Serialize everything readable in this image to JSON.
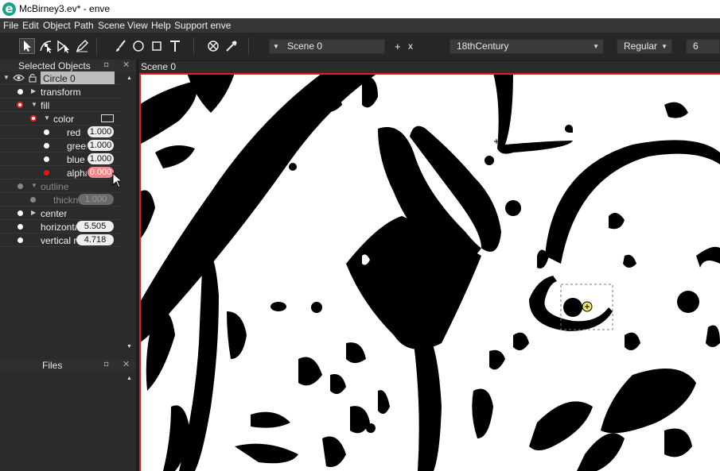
{
  "window": {
    "title": "McBirney3.ev* - enve",
    "app_icon": "enve-logo-icon"
  },
  "menu": [
    "File",
    "Edit",
    "Object",
    "Path",
    "Scene",
    "View",
    "Help",
    "Support enve"
  ],
  "toolbar": {
    "tools": [
      "pointer-icon",
      "node-edit-icon",
      "path-edit-icon",
      "pen-icon",
      "brush-icon",
      "circle-icon",
      "rectangle-icon",
      "text-icon",
      "null-object-icon",
      "color-picker-icon"
    ],
    "scene_select": "Scene 0",
    "add_label": "+",
    "remove_label": "x",
    "font_family": "18thCentury",
    "font_style": "Regular",
    "font_size": "6"
  },
  "selected_objects_panel": {
    "title": "Selected Objects",
    "object_name": "Circle 0",
    "rows": {
      "transform": "transform",
      "fill": "fill",
      "color": "color",
      "red": "red",
      "red_value": "1.000",
      "green": "green",
      "green_value": "1.000",
      "blue": "blue",
      "blue_value": "1.000",
      "alpha": "alpha",
      "alpha_value": "0.000",
      "outline": "outline",
      "thickness": "thickness",
      "thickness_value": "1.000",
      "center": "center",
      "horizontal": "horizontal radius",
      "horizontal_value": "5.505",
      "vertical": "vertical radius",
      "vertical_value": "4.718"
    },
    "colors": {
      "alpha_warning": "#f08a8a",
      "keyframe_dot": "#e11111"
    }
  },
  "files_panel": {
    "title": "Files"
  },
  "scene_tab": {
    "label": "Scene 0"
  },
  "canvas": {
    "border_color": "#e02020",
    "background": "#ffffff"
  }
}
